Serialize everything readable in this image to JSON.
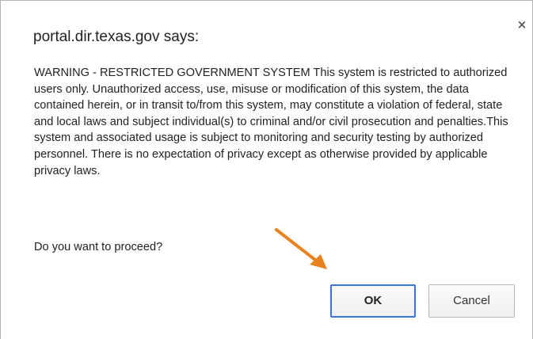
{
  "dialog": {
    "title": "portal.dir.texas.gov says:",
    "close_symbol": "×",
    "message": "WARNING - RESTRICTED GOVERNMENT SYSTEM This system is restricted to authorized users only. Unauthorized access, use, misuse or modification of this system, the data contained herein, or in transit to/from this system, may constitute a violation of federal, state and local laws and subject individual(s) to criminal and/or civil prosecution and penalties.This system and associated usage is subject to monitoring and security testing by authorized personnel. There is no expectation of privacy except as otherwise provided by applicable privacy laws.",
    "prompt": "Do you want to proceed?",
    "ok_label": "OK",
    "cancel_label": "Cancel"
  },
  "annotation": {
    "icon": "arrow-icon",
    "color": "#e8821e"
  },
  "colors": {
    "focus_border": "#3b73d6",
    "text": "#222222"
  }
}
